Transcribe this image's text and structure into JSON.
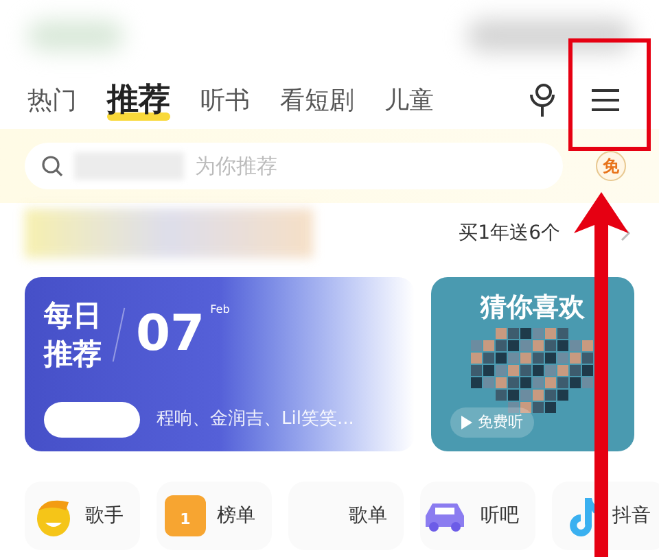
{
  "tabs": [
    {
      "label": "热门",
      "selected": false
    },
    {
      "label": "推荐",
      "selected": true
    },
    {
      "label": "听书",
      "selected": false
    },
    {
      "label": "看短剧",
      "selected": false
    },
    {
      "label": "儿童",
      "selected": false
    }
  ],
  "search": {
    "placeholder": "为你推荐"
  },
  "free_badge": "免",
  "promo": "买1年送6个",
  "daily": {
    "title_lines": [
      "每日",
      "推荐"
    ],
    "day": "07",
    "month": "Feb",
    "artists": "程响、金润吉、Lil笑笑..."
  },
  "guess": {
    "title": "猜你喜欢",
    "button": "免费听"
  },
  "shortcuts": [
    {
      "kind": "singer",
      "label": "歌手"
    },
    {
      "kind": "chart",
      "label": "榜单",
      "icon_text": "1"
    },
    {
      "kind": "blank",
      "label": "歌单"
    },
    {
      "kind": "car",
      "label": "听吧"
    },
    {
      "kind": "note",
      "label": "抖音"
    }
  ]
}
